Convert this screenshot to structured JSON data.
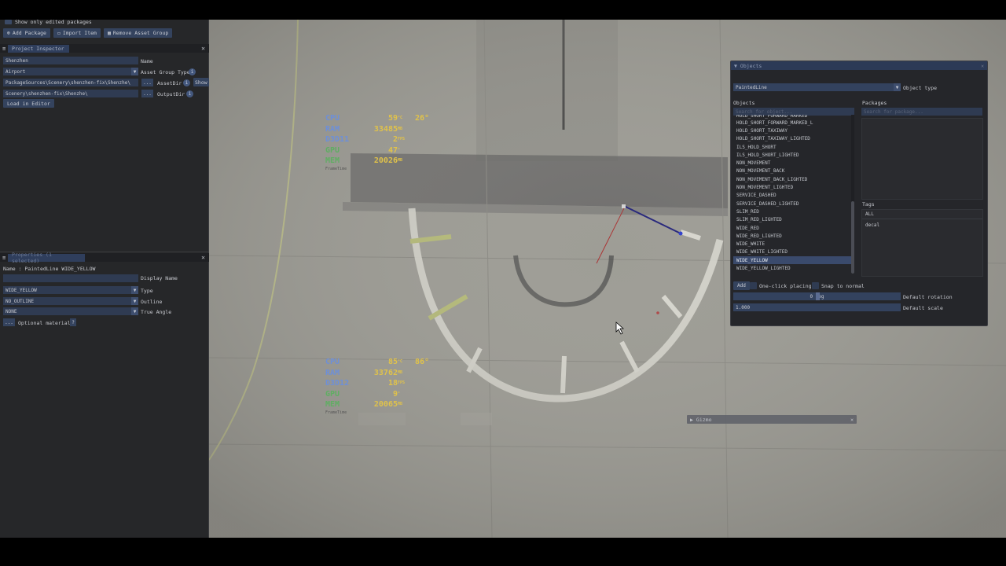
{
  "left_panel": {
    "show_only_edited_label": "Show only edited packages",
    "toolbar": {
      "add_package": "Add Package",
      "import_item": "Import Item",
      "remove_asset_group": "Remove Asset Group"
    },
    "project_inspector": {
      "tab_label": "Project Inspector",
      "name_value": "Shenzhen",
      "name_label": "Name",
      "asset_group_type_value": "Airport",
      "asset_group_type_label": "Asset Group Type",
      "asset_dir_value": "PackageSources\\Scenery\\shenzhen-fix\\Shenzhe\\",
      "asset_dir_label": "AssetDir",
      "show_button": "Show",
      "output_dir_value": "Scenery\\shenzhen-fix\\Shenzhe\\",
      "output_dir_label": "OutputDir",
      "dots": "...",
      "load_in_editor": "Load in Editor"
    },
    "properties": {
      "tab_label": "Properties (1 selected)",
      "name_line": "Name : PaintedLine WIDE_YELLOW",
      "display_name_label": "Display Name",
      "type_value": "WIDE_YELLOW",
      "type_label": "Type",
      "outline_value": "NO_OUTLINE",
      "outline_label": "Outline",
      "true_angle_value": "NONE",
      "true_angle_label": "True Angle",
      "optional_material_label": "Optional material",
      "dots": "...",
      "optional_material_extra": "?"
    }
  },
  "hud_top": {
    "rows": [
      {
        "key": "CPU",
        "value": "59",
        "unit": "°C",
        "extra": "26°",
        "color": "#6d8fd8"
      },
      {
        "key": "RAM",
        "value": "33485",
        "unit": "MB",
        "extra": "",
        "color": "#6d8fd8"
      },
      {
        "key": "D3D11",
        "value": "2",
        "unit": "FPS",
        "extra": "",
        "color": "#6d8fd8"
      },
      {
        "key": "GPU",
        "value": "47",
        "unit": "°",
        "extra": "",
        "color": "#5fae62"
      },
      {
        "key": "MEM",
        "value": "20026",
        "unit": "MB",
        "extra": "",
        "color": "#5fae62"
      }
    ],
    "sub": "FrameTime"
  },
  "hud_bottom": {
    "rows": [
      {
        "key": "CPU",
        "value": "85",
        "unit": "°C",
        "extra": "86°",
        "color": "#6d8fd8"
      },
      {
        "key": "RAM",
        "value": "33762",
        "unit": "MB",
        "extra": "",
        "color": "#6d8fd8"
      },
      {
        "key": "D3D12",
        "value": "18",
        "unit": "FPS",
        "extra": "",
        "color": "#6d8fd8"
      },
      {
        "key": "GPU",
        "value": "9",
        "unit": "°",
        "extra": "",
        "color": "#5fae62"
      },
      {
        "key": "MEM",
        "value": "20065",
        "unit": "MB",
        "extra": "",
        "color": "#5fae62"
      }
    ],
    "sub": "FrameTime"
  },
  "objects_window": {
    "title": "Objects",
    "object_type_value": "PaintedLine",
    "object_type_label": "Object type",
    "objects_label": "Objects",
    "packages_label": "Packages",
    "search_objects_placeholder": "Search for object...",
    "search_packages_placeholder": "Search for package...",
    "items": [
      "HOLD_SHORT_FORWARD_MARKED",
      "HOLD_SHORT_FORWARD_MARKED_L",
      "HOLD_SHORT_TAXIWAY",
      "HOLD_SHORT_TAXIWAY_LIGHTED",
      "ILS_HOLD_SHORT",
      "ILS_HOLD_SHORT_LIGHTED",
      "NON_MOVEMENT",
      "NON_MOVEMENT_BACK",
      "NON_MOVEMENT_BACK_LIGHTED",
      "NON_MOVEMENT_LIGHTED",
      "SERVICE_DASHED",
      "SERVICE_DASHED_LIGHTED",
      "SLIM_RED",
      "SLIM_RED_LIGHTED",
      "WIDE_RED",
      "WIDE_RED_LIGHTED",
      "WIDE_WHITE",
      "WIDE_WHITE_LIGHTED",
      "WIDE_YELLOW",
      "WIDE_YELLOW_LIGHTED"
    ],
    "selected_item": "WIDE_YELLOW",
    "tags_label": "Tags",
    "tags": [
      "ALL",
      "decal"
    ],
    "add_button": "Add",
    "one_click_label": "One-click placing",
    "snap_label": "Snap to normal",
    "rotation_value": "0 deg",
    "rotation_label": "Default rotation",
    "scale_value": "1.000",
    "scale_label": "Default scale"
  },
  "gizmo": {
    "label": "Gizmo"
  }
}
